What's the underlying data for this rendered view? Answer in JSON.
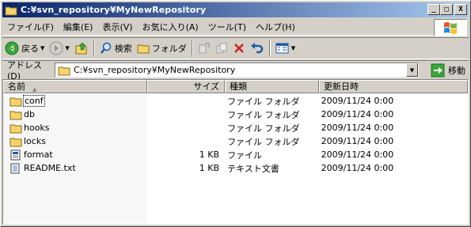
{
  "window": {
    "title": "C:¥svn_repository¥MyNewRepository",
    "minimize": "_",
    "maximize": "□",
    "close": "X"
  },
  "menu": [
    {
      "label": "ファイル(F)"
    },
    {
      "label": "編集(E)"
    },
    {
      "label": "表示(V)"
    },
    {
      "label": "お気に入り(A)"
    },
    {
      "label": "ツール(T)"
    },
    {
      "label": "ヘルプ(H)"
    }
  ],
  "toolbar": {
    "back_label": "戻る",
    "search_label": "検索",
    "folders_label": "フォルダ"
  },
  "address": {
    "label": "アドレス(D)",
    "value": "C:¥svn_repository¥MyNewRepository",
    "go_label": "移動"
  },
  "columns": {
    "name": "名前",
    "size": "サイズ",
    "type": "種類",
    "modified": "更新日時"
  },
  "files": [
    {
      "name": "conf",
      "size": "",
      "type": "ファイル フォルダ",
      "modified": "2009/11/24 0:00",
      "icon": "folder-icon"
    },
    {
      "name": "db",
      "size": "",
      "type": "ファイル フォルダ",
      "modified": "2009/11/24 0:00",
      "icon": "folder-icon"
    },
    {
      "name": "hooks",
      "size": "",
      "type": "ファイル フォルダ",
      "modified": "2009/11/24 0:00",
      "icon": "folder-icon"
    },
    {
      "name": "locks",
      "size": "",
      "type": "ファイル フォルダ",
      "modified": "2009/11/24 0:00",
      "icon": "folder-icon"
    },
    {
      "name": "format",
      "size": "1 KB",
      "type": "ファイル",
      "modified": "2009/11/24 0:00",
      "icon": "file-icon"
    },
    {
      "name": "README.txt",
      "size": "1 KB",
      "type": "テキスト文書",
      "modified": "2009/11/24 0:00",
      "icon": "text-file-icon"
    }
  ],
  "colors": {
    "title_start": "#0a246a",
    "title_end": "#a6caf0",
    "folder": "#f6d46a"
  }
}
